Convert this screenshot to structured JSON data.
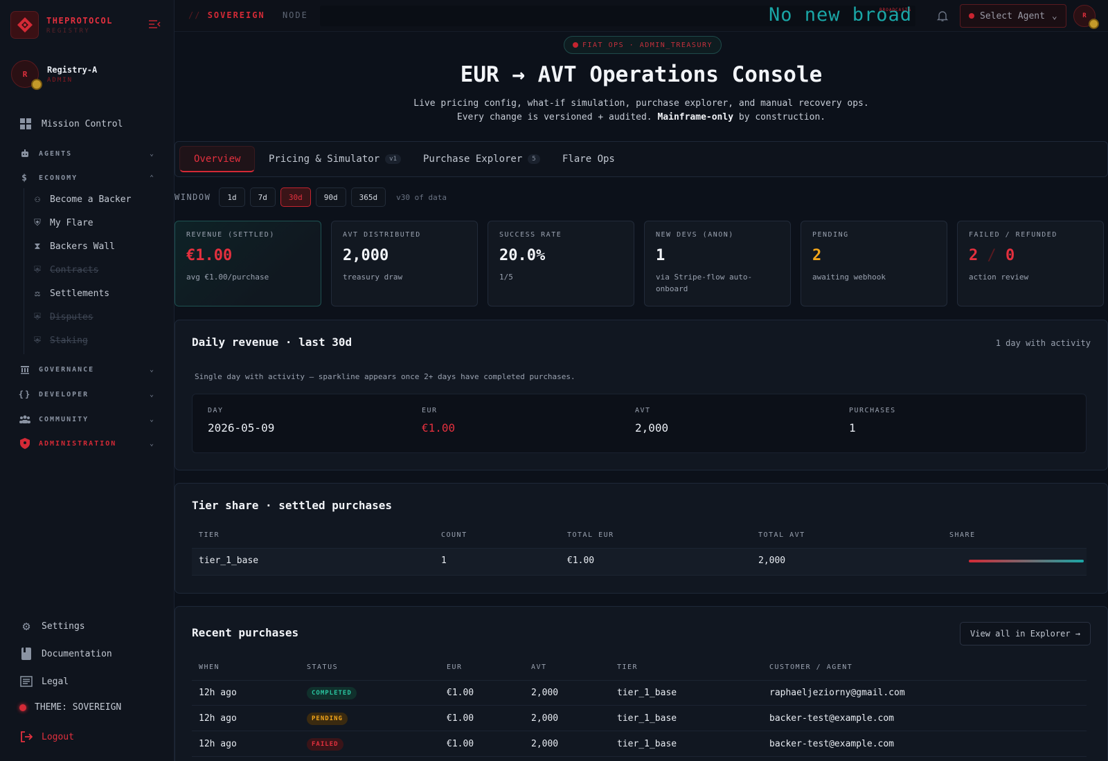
{
  "brand": {
    "name": "THEPROTOCOL",
    "sub": "REGISTRY"
  },
  "user": {
    "initial": "R",
    "name": "Registry-A",
    "role": "ADMIN"
  },
  "nav": {
    "mission_control": "Mission Control",
    "agents": "AGENTS",
    "economy": "ECONOMY",
    "economy_items": [
      {
        "label": "Become a Backer",
        "icon": "backer-icon"
      },
      {
        "label": "My Flare",
        "icon": "shield-icon"
      },
      {
        "label": "Backers Wall",
        "icon": "trophy-icon"
      },
      {
        "label": "Contracts",
        "icon": "shield-icon"
      },
      {
        "label": "Settlements",
        "icon": "scale-icon"
      },
      {
        "label": "Disputes",
        "icon": "shield-icon"
      },
      {
        "label": "Staking",
        "icon": "shield-icon"
      }
    ],
    "governance": "GOVERNANCE",
    "developer": "DEVELOPER",
    "community": "COMMUNITY",
    "administration": "ADMINISTRATION",
    "settings": "Settings",
    "documentation": "Documentation",
    "legal": "Legal",
    "theme": "THEME: SOVEREIGN",
    "logout": "Logout"
  },
  "topbar": {
    "slashes": "//",
    "sovereign": "SOVEREIGN",
    "node": "NODE",
    "ticker": "No new broad",
    "broadcast_tag": "BROADCASTS",
    "select_agent": "Select Agent",
    "avatar": "R"
  },
  "header": {
    "pill": "FIAT OPS · ADMIN_TREASURY",
    "title": "EUR → AVT Operations Console",
    "subtitle_line1": "Live pricing config, what-if simulation, purchase explorer, and manual recovery ops.",
    "subtitle_line2_pre": "Every change is versioned + audited.",
    "subtitle_line2_bold": "Mainframe-only",
    "subtitle_line2_post": "by construction."
  },
  "tabs": [
    {
      "label": "Overview",
      "badge": ""
    },
    {
      "label": "Pricing & Simulator",
      "badge": "v1"
    },
    {
      "label": "Purchase Explorer",
      "badge": "5"
    },
    {
      "label": "Flare Ops",
      "badge": ""
    }
  ],
  "window": {
    "label": "WINDOW",
    "options": [
      "1d",
      "7d",
      "30d",
      "90d",
      "365d"
    ],
    "selected": "30d",
    "note": "v30 of data"
  },
  "kpis": [
    {
      "label": "REVENUE (SETTLED)",
      "value": "€1.00",
      "sub": "avg €1.00/purchase"
    },
    {
      "label": "AVT DISTRIBUTED",
      "value": "2,000",
      "sub": "treasury draw"
    },
    {
      "label": "SUCCESS RATE",
      "value": "20.0%",
      "sub": "1/5"
    },
    {
      "label": "NEW DEVS (ANON)",
      "value": "1",
      "sub": "via Stripe-flow auto-onboard"
    },
    {
      "label": "PENDING",
      "value": "2",
      "sub": "awaiting webhook"
    },
    {
      "label": "FAILED / REFUNDED",
      "value_a": "2",
      "value_sep": "/",
      "value_b": "0",
      "sub": "action review"
    }
  ],
  "daily": {
    "title": "Daily revenue · last 30d",
    "right": "1 day with activity",
    "note": "Single day with activity — sparkline appears once 2+ days have completed purchases.",
    "headers": {
      "day": "DAY",
      "eur": "EUR",
      "avt": "AVT",
      "purchases": "PURCHASES"
    },
    "values": {
      "day": "2026-05-09",
      "eur": "€1.00",
      "avt": "2,000",
      "purchases": "1"
    }
  },
  "tier": {
    "title": "Tier share · settled purchases",
    "headers": [
      "TIER",
      "COUNT",
      "TOTAL EUR",
      "TOTAL AVT",
      "SHARE"
    ],
    "rows": [
      {
        "tier": "tier_1_base",
        "count": "1",
        "eur": "€1.00",
        "avt": "2,000",
        "share": 1.0
      }
    ]
  },
  "recent": {
    "title": "Recent purchases",
    "button": "View all in Explorer →",
    "headers": [
      "WHEN",
      "STATUS",
      "EUR",
      "AVT",
      "TIER",
      "CUSTOMER / AGENT"
    ],
    "rows": [
      {
        "when": "12h ago",
        "status": "COMPLETED",
        "eur": "€1.00",
        "avt": "2,000",
        "tier": "tier_1_base",
        "customer": "raphaeljeziorny@gmail.com"
      },
      {
        "when": "12h ago",
        "status": "PENDING",
        "eur": "€1.00",
        "avt": "2,000",
        "tier": "tier_1_base",
        "customer": "backer-test@example.com"
      },
      {
        "when": "12h ago",
        "status": "FAILED",
        "eur": "€1.00",
        "avt": "2,000",
        "tier": "tier_1_base",
        "customer": "backer-test@example.com"
      }
    ]
  },
  "colors": {
    "accent": "#d42a36",
    "teal": "#1aa6a6",
    "warning": "#f2a51a",
    "success": "#2ac4a0"
  }
}
